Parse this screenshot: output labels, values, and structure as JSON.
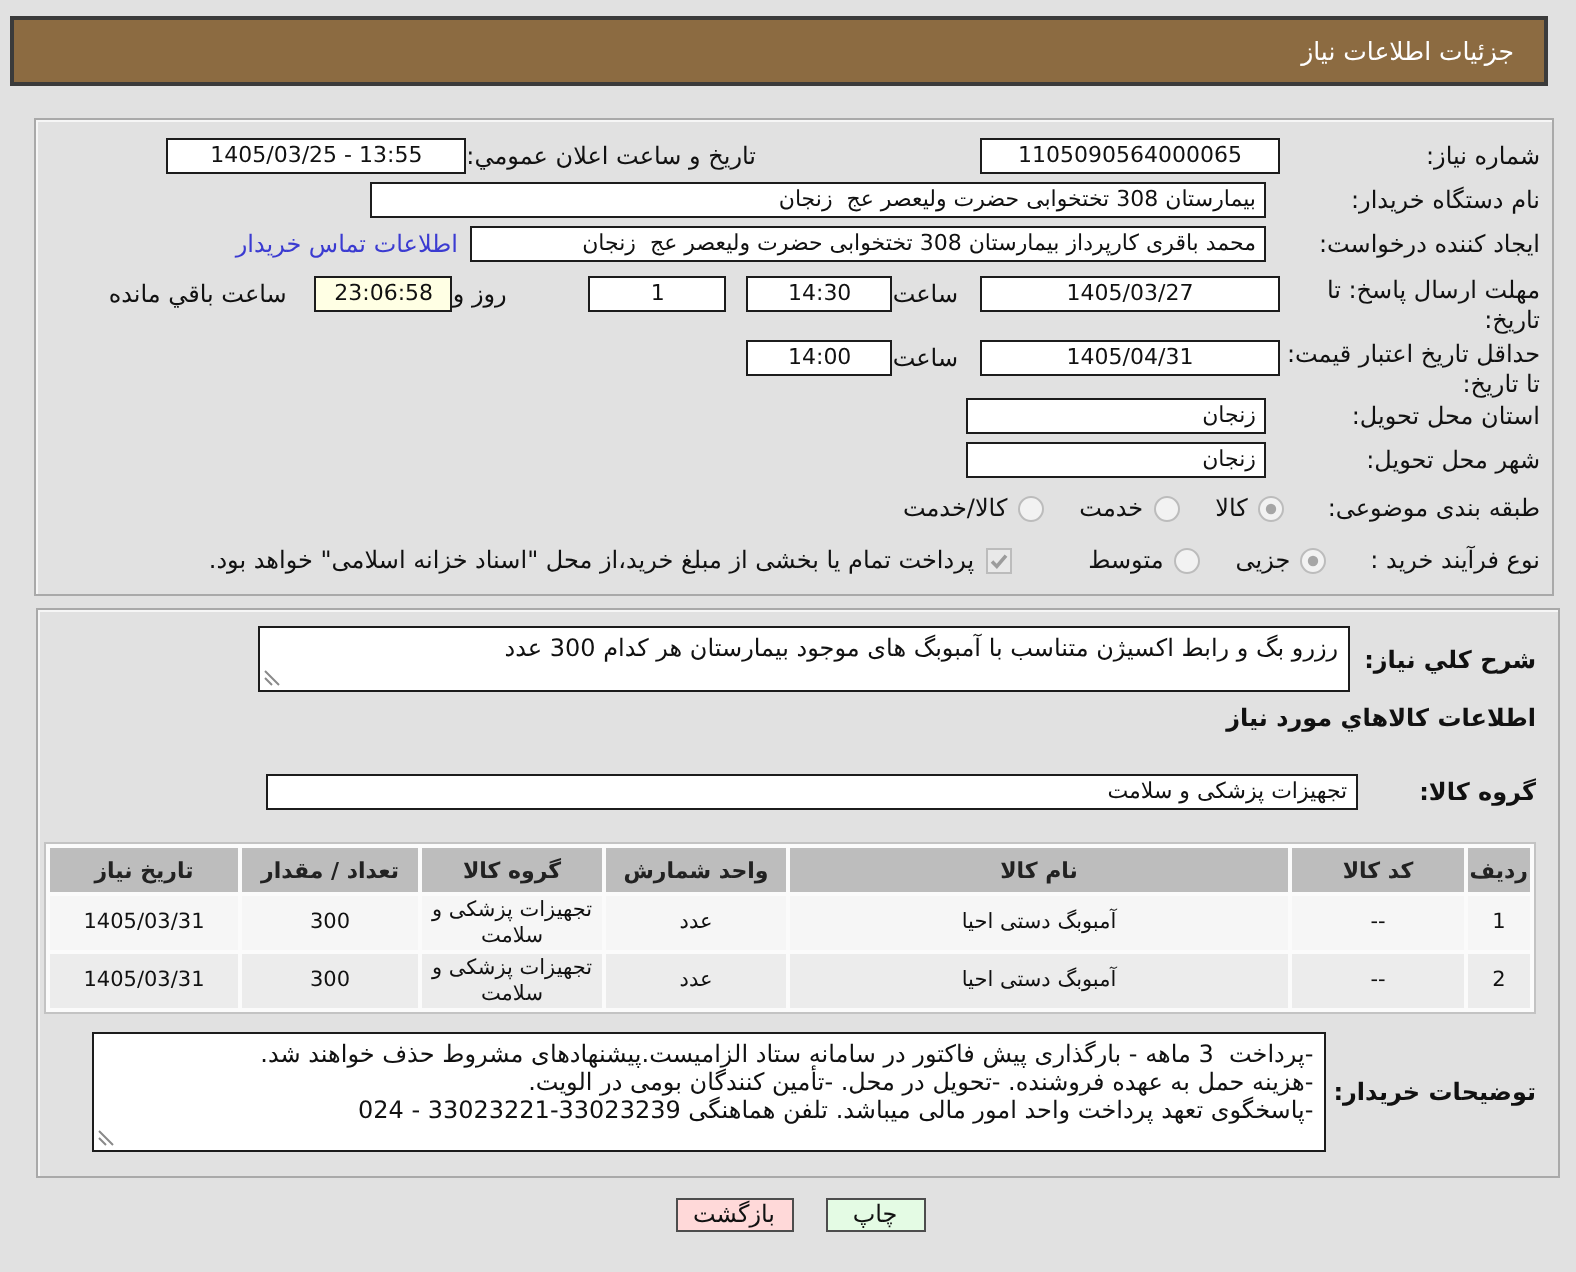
{
  "title_bar": {
    "title": "جزئیات اطلاعات نیاز"
  },
  "need_details": {
    "rows": [
      {
        "kind": "pair",
        "label": "شماره نیاز:",
        "value": "1105090564000065",
        "side_label": "تاریخ و ساعت اعلان عمومي:",
        "side_value": "1405/03/25 - 13:55"
      },
      {
        "kind": "wide",
        "label": "نام دستگاه خریدار:",
        "value": "بیمارستان 308 تختخوابی حضرت ولیعصر عج  زنجان"
      },
      {
        "kind": "link",
        "label": "ایجاد کننده درخواست:",
        "value": "محمد باقری کارپرداز بیمارستان 308 تختخوابی حضرت ولیعصر عج  زنجان",
        "link": "اطلاعات تماس خریدار"
      },
      {
        "kind": "deadline",
        "label": "مهلت ارسال پاسخ: تا تاریخ:",
        "date": "1405/03/27",
        "time_label": "ساعت",
        "time": "14:30",
        "days": "1",
        "days_label": "روز و",
        "remaining": "23:06:58",
        "remaining_label": "ساعت باقي مانده"
      },
      {
        "kind": "deadline",
        "label": "حداقل تاریخ اعتبار قیمت: تا تاریخ:",
        "date": "1405/04/31",
        "time_label": "ساعت",
        "time": "14:00"
      },
      {
        "kind": "short",
        "label": "استان محل تحویل:",
        "value": "زنجان"
      },
      {
        "kind": "short",
        "label": "شهر محل تحویل:",
        "value": "زنجان"
      },
      {
        "kind": "choice",
        "label": "طبقه بندی موضوعی:",
        "options": [
          {
            "label": "کالا",
            "selected": true
          },
          {
            "label": "خدمت",
            "selected": false
          },
          {
            "label": "کالا/خدمت",
            "selected": false
          }
        ]
      },
      {
        "kind": "choice",
        "label": "نوع فرآیند خرید :",
        "options": [
          {
            "label": "جزیی",
            "selected": true
          },
          {
            "label": "متوسط",
            "selected": false
          }
        ],
        "checkbox": {
          "label": "پرداخت تمام یا بخشی از مبلغ خرید،از محل \"اسناد خزانه اسلامی\" خواهد بود.",
          "checked": true
        }
      }
    ]
  },
  "need_summary": {
    "label": "شرح کلي نياز:",
    "text": "رزرو بگ و رابط اکسیژن متناسب با آمبوبگ های موجود بیمارستان هر کدام 300 عدد"
  },
  "goods": {
    "title": "اطلاعات کالاهاي مورد نياز",
    "group_label": "گروه کالا:",
    "group_value": "تجهیزات پزشکی و سلامت",
    "table": {
      "columns": [
        "ردیف",
        "کد کالا",
        "نام کالا",
        "واحد شمارش",
        "گروه کالا",
        "تعداد / مقدار",
        "تاریخ نیاز"
      ],
      "rows": [
        [
          "1",
          "--",
          "آمبوبگ دستی احیا",
          "عدد",
          "تجهیزات پزشکی و سلامت",
          "300",
          "1405/03/31"
        ],
        [
          "2",
          "--",
          "آمبوبگ دستی احیا",
          "عدد",
          "تجهیزات پزشکی و سلامت",
          "300",
          "1405/03/31"
        ]
      ]
    }
  },
  "buyer_notes": {
    "label": "توضیحات خریدار:",
    "lines": [
      "-پرداخت  3 ماهه - بارگذاری پیش فاکتور در سامانه ستاد الزامیست.پیشنهادهای مشروط حذف خواهند شد.",
      "-هزینه حمل به عهده فروشنده. -تحویل در محل. -تأمین کنندگان بومی در الویت.",
      "-پاسخگوی تعهد پرداخت واحد امور مالی میباشد. تلفن هماهنگی 33023239-33023221 - 024"
    ]
  },
  "buttons": [
    {
      "kind": "print",
      "label": "چاپ"
    },
    {
      "kind": "back",
      "label": "بازگشت"
    }
  ]
}
